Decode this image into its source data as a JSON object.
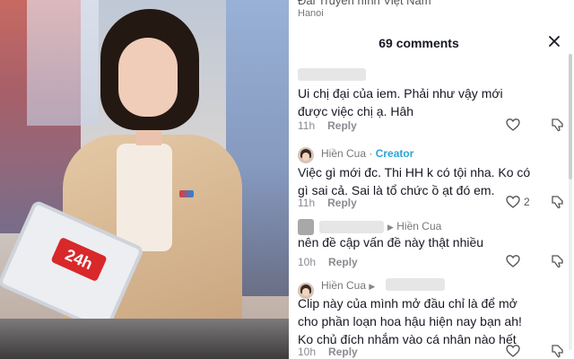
{
  "header": {
    "channel_name": "Đài Truyền hình Việt Nam",
    "location": "Hanoi"
  },
  "comments_panel": {
    "count_label": "69 comments"
  },
  "photo": {
    "logo_text": "24h"
  },
  "comments": [
    {
      "author": "",
      "text": "Ui chị đại của iem. Phải như vậy mới được việc chị ạ. Hâh",
      "time": "11h",
      "reply_label": "Reply",
      "likes": ""
    },
    {
      "author": "Hiền Cua",
      "creator_label": "Creator",
      "text": "Việc gì mới đc. Thi HH k có tội nha. Ko có gì sai cả. Sai là tổ chức ồ ạt đó em.",
      "time": "11h",
      "reply_label": "Reply",
      "likes": "2"
    },
    {
      "author": "",
      "reply_to": "Hiền Cua",
      "text": "nên đề cập vấn đề này thật nhiều",
      "time": "10h",
      "reply_label": "Reply",
      "likes": ""
    },
    {
      "author": "Hiền Cua",
      "reply_to": "",
      "text": "Clip này của mình mở đầu chỉ là để mở cho phần loạn hoa hậu hiện nay bạn ah! Ko chủ đích nhắm vào cá nhân nào hết",
      "time": "10h",
      "reply_label": "Reply",
      "likes": ""
    }
  ],
  "colors": {
    "creator": "#2aa4d8",
    "text": "#161823",
    "muted": "#8a8b91"
  }
}
